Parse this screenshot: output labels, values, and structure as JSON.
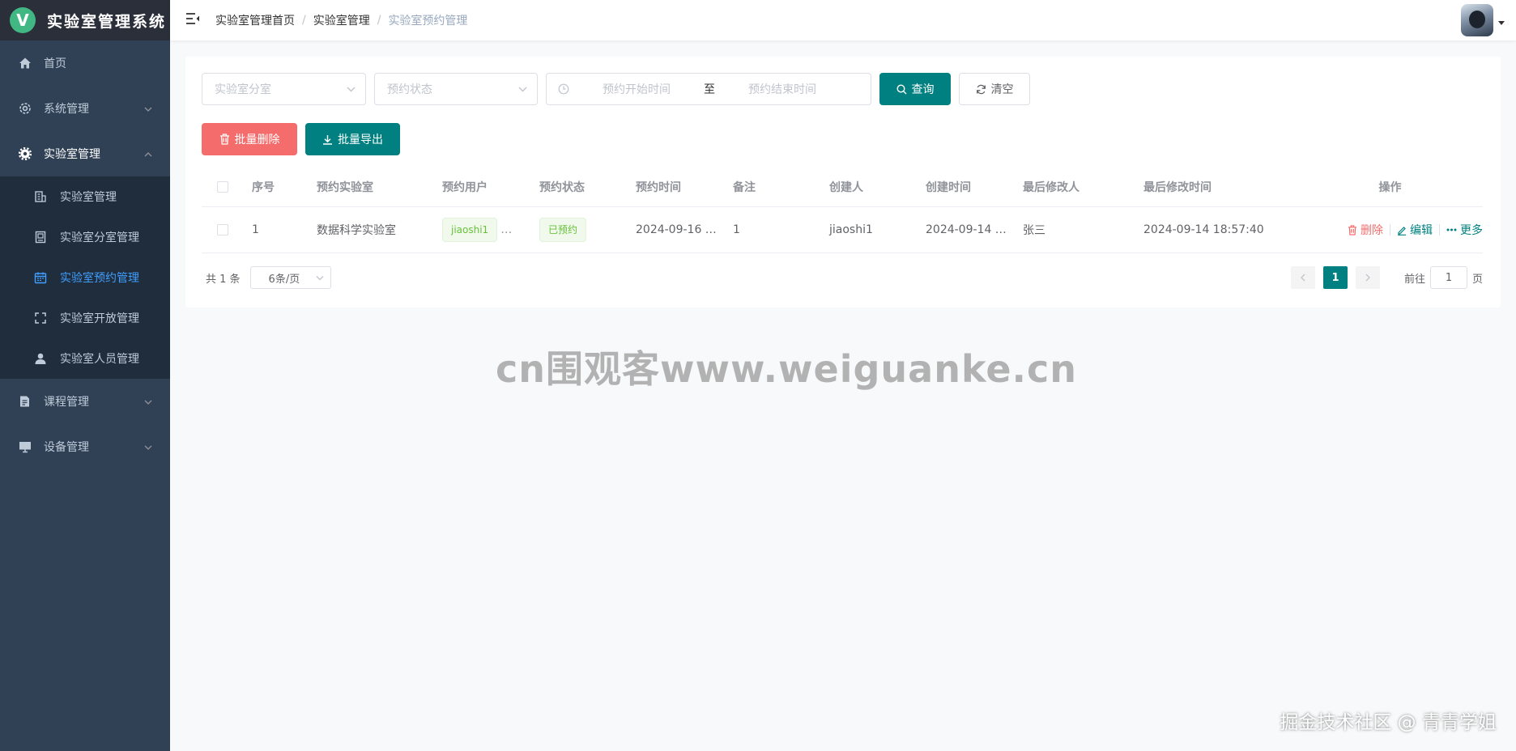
{
  "app": {
    "logo_letter": "V",
    "title": "实验室管理系统"
  },
  "sidebar": {
    "menus": [
      {
        "label": "首页",
        "icon": "home-icon"
      },
      {
        "label": "系统管理",
        "icon": "gear-icon"
      },
      {
        "label": "实验室管理",
        "icon": "cog-icon",
        "open": true
      }
    ],
    "lab_sub": [
      {
        "label": "实验室管理",
        "icon": "building-icon"
      },
      {
        "label": "实验室分室管理",
        "icon": "office-icon"
      },
      {
        "label": "实验室预约管理",
        "icon": "calendar-icon",
        "active": true
      },
      {
        "label": "实验室开放管理",
        "icon": "fullscreen-icon"
      },
      {
        "label": "实验室人员管理",
        "icon": "user-icon"
      }
    ],
    "menus_after": [
      {
        "label": "课程管理",
        "icon": "document-icon"
      },
      {
        "label": "设备管理",
        "icon": "monitor-icon"
      }
    ],
    "colors": {
      "bg": "#304156",
      "active": "#409eff"
    }
  },
  "header": {
    "breadcrumb": [
      "实验室管理首页",
      "实验室管理",
      "实验室预约管理"
    ],
    "separator": "/"
  },
  "search": {
    "room_placeholder": "实验室分室",
    "status_placeholder": "预约状态",
    "start_placeholder": "预约开始时间",
    "range_separator": "至",
    "end_placeholder": "预约结束时间",
    "query_label": "查询",
    "clear_label": "清空"
  },
  "actions": {
    "batch_delete": "批量删除",
    "batch_export": "批量导出"
  },
  "table": {
    "columns": [
      "序号",
      "预约实验室",
      "预约用户",
      "预约状态",
      "预约时间",
      "备注",
      "创建人",
      "创建时间",
      "最后修改人",
      "最后修改时间",
      "操作"
    ],
    "rows": [
      {
        "index": "1",
        "lab": "数据科学实验室",
        "user": "jiaoshi1",
        "user_more": "…",
        "status": "已预约",
        "time": "2024-09-16 …",
        "remark": "1",
        "creator": "jiaoshi1",
        "created": "2024-09-14 …",
        "modifier": "张三",
        "modified": "2024-09-14 18:57:40",
        "ops": {
          "delete": "删除",
          "edit": "编辑",
          "more": "更多"
        }
      }
    ]
  },
  "pagination": {
    "total_text": "共 1 条",
    "page_size": "6条/页",
    "current_page": "1",
    "goto_prefix": "前往",
    "goto_value": "1",
    "goto_suffix": "页"
  },
  "watermark": "cn围观客www.weiguanke.cn",
  "credit": "掘金技术社区 @ 青青学姐",
  "theme": {
    "primary": "#008080",
    "danger": "#f56c6c",
    "success": "#67c23a"
  }
}
